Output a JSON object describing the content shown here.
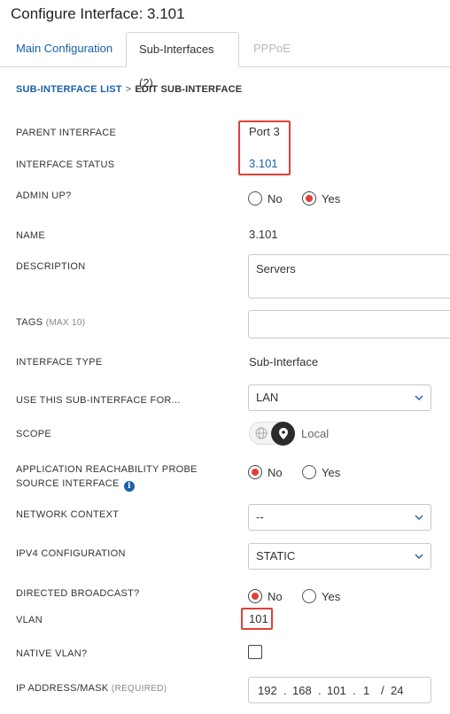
{
  "window": {
    "title": "Configure Interface: 3.101"
  },
  "tabs": [
    {
      "label": "Main Configuration"
    },
    {
      "label": "Sub-Interfaces (2)"
    },
    {
      "label": "PPPoE"
    }
  ],
  "breadcrumb": {
    "parent": "SUB-INTERFACE LIST",
    "separator": ">",
    "current": "EDIT SUB-INTERFACE"
  },
  "fields": {
    "parent_interface": {
      "label": "PARENT INTERFACE",
      "value": "Port 3"
    },
    "interface_status": {
      "label": "INTERFACE STATUS",
      "value": "3.101"
    },
    "admin_up": {
      "label": "ADMIN UP?",
      "options": [
        "No",
        "Yes"
      ],
      "selected": "Yes"
    },
    "name": {
      "label": "NAME",
      "value": "3.101"
    },
    "description": {
      "label": "DESCRIPTION",
      "value": "Servers"
    },
    "tags": {
      "label": "TAGS",
      "hint": "(MAX 10)",
      "value": ""
    },
    "interface_type": {
      "label": "INTERFACE TYPE",
      "value": "Sub-Interface"
    },
    "use_for": {
      "label": "USE THIS SUB-INTERFACE FOR...",
      "value": "LAN"
    },
    "scope": {
      "label": "SCOPE",
      "value": "Local",
      "icons": [
        "globe-icon",
        "location-pin-icon"
      ]
    },
    "app_probe": {
      "label_line1": "APPLICATION REACHABILITY PROBE",
      "label_line2": "SOURCE INTERFACE",
      "options": [
        "No",
        "Yes"
      ],
      "selected": "No",
      "info_glyph": "i"
    },
    "network_context": {
      "label": "NETWORK CONTEXT",
      "value": "--"
    },
    "ipv4_config": {
      "label": "IPV4 CONFIGURATION",
      "value": "STATIC"
    },
    "directed_broadcast": {
      "label": "DIRECTED BROADCAST?",
      "options": [
        "No",
        "Yes"
      ],
      "selected": "No"
    },
    "vlan": {
      "label": "VLAN",
      "value": "101"
    },
    "native_vlan": {
      "label": "NATIVE VLAN?",
      "checked": false
    },
    "ip_address": {
      "label": "IP ADDRESS/MASK",
      "hint": "(REQUIRED)",
      "octets": [
        "192",
        "168",
        "101",
        "1"
      ],
      "mask": "24",
      "dot": ".",
      "slash": "/"
    }
  },
  "colors": {
    "accent": "#1a5fa8",
    "highlight": "#e0403a",
    "radio_selected": "#e0403a"
  }
}
